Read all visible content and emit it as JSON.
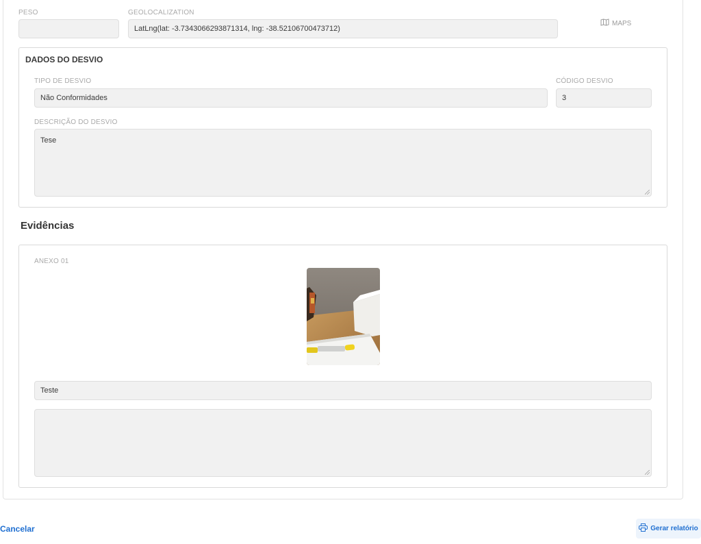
{
  "top_fields": {
    "peso_label": "PESO",
    "peso_value": "",
    "geo_label": "GEOLOCALIZATION",
    "geo_value": "LatLng(lat: -3.7343066293871314, lng: -38.52106700473712)",
    "maps_label": "MAPS"
  },
  "desvio": {
    "title": "DADOS DO DESVIO",
    "tipo_label": "TIPO DE DESVIO",
    "tipo_value": "Não Conformidades",
    "codigo_label": "CÓDIGO DESVIO",
    "codigo_value": "3",
    "descricao_label": "DESCRIÇÃO DO DESVIO",
    "descricao_value": "Tese"
  },
  "evidencias": {
    "title": "Evidências",
    "anexo_label": "ANEXO 01",
    "caption_value": "Teste",
    "notes_value": ""
  },
  "footer": {
    "cancel_label": "Cancelar",
    "report_label": "Gerar relatório"
  },
  "icons": {
    "maps": "map-icon",
    "report": "printer-icon"
  }
}
